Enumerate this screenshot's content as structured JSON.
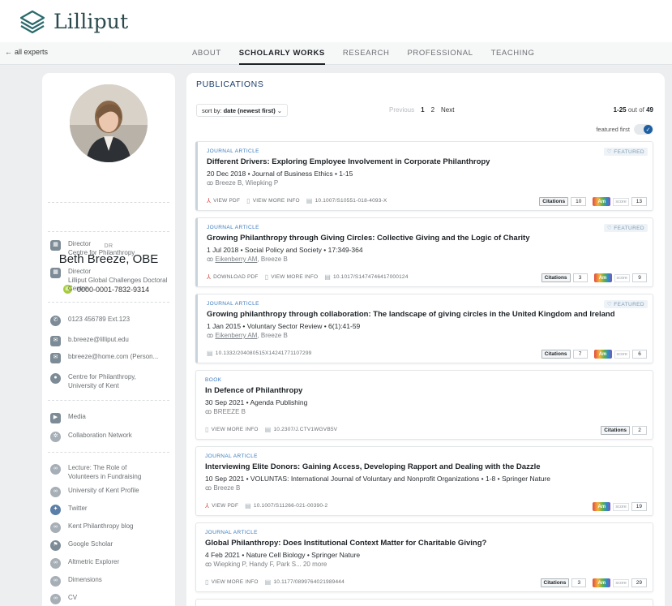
{
  "brand": {
    "name": "Lilliput"
  },
  "nav": {
    "back_label": "all experts",
    "tabs": [
      "ABOUT",
      "SCHOLARLY WORKS",
      "RESEARCH",
      "PROFESSIONAL",
      "TEACHING"
    ],
    "active_tab": "SCHOLARLY WORKS"
  },
  "profile": {
    "prefix": "DR",
    "name": "Beth Breeze, OBE",
    "orcid": "0000-0001-7832-9314",
    "orcid_badge": "iD",
    "positions": [
      {
        "title": "Director",
        "org": "Centre for Philanthropy"
      },
      {
        "title": "Director",
        "org": "Lilliput Global Challenges Doctoral Centre"
      }
    ],
    "contacts": {
      "phone": "0123 456789 Ext.123",
      "email_work": "b.breeze@lilliput.edu",
      "email_personal": "bbreeze@home.com (Person...",
      "location": "Centre for Philanthropy, University of Kent"
    },
    "media_links": [
      "Media",
      "Collaboration Network"
    ],
    "web_links": [
      "Lecture: The Role of Volunteers in Fundraising",
      "University of Kent Profile",
      "Twitter",
      "Kent Philanthropy blog",
      "Google Scholar",
      "Altmetric Explorer",
      "Dimensions",
      "CV"
    ]
  },
  "publications": {
    "heading": "PUBLICATIONS",
    "sort_prefix": "sort by:",
    "sort_value": "date (newest first)",
    "pager": {
      "previous": "Previous",
      "pages": [
        "1",
        "2"
      ],
      "current": "1",
      "next": "Next"
    },
    "range": "1-25",
    "out_of": "out of",
    "total": "49",
    "featured_first_label": "featured first",
    "citations_label": "Citations",
    "altmetric_label": "Am",
    "score_label": "score",
    "featured_label": "FEATURED",
    "items": [
      {
        "type": "JOURNAL ARTICLE",
        "featured": true,
        "title": "Different Drivers: Exploring Employee Involvement in Corporate Philanthropy",
        "meta": "20 Dec 2018  •  Journal of Business Ethics  •  1-15",
        "authors_plain": "Breeze B, Wiepking P",
        "authors_linked": "",
        "links": [
          "VIEW PDF",
          "VIEW MORE INFO"
        ],
        "doi": "10.1007/S10551-018-4093-X",
        "citations": "10",
        "altmetric": "13"
      },
      {
        "type": "JOURNAL ARTICLE",
        "featured": true,
        "title": "Growing Philanthropy through Giving Circles: Collective Giving and the Logic of Charity",
        "meta": "1 Jul 2018  •  Social Policy and Society  •  17:349-364",
        "authors_plain": ", Breeze B",
        "authors_linked": "Eikenberry AM",
        "links": [
          "DOWNLOAD PDF",
          "VIEW MORE INFO"
        ],
        "doi": "10.1017/S1474746417000124",
        "citations": "3",
        "altmetric": "9"
      },
      {
        "type": "JOURNAL ARTICLE",
        "featured": true,
        "title": "Growing philanthropy through collaboration: The landscape of giving circles in the United Kingdom and Ireland",
        "meta": "1 Jan 2015  •  Voluntary Sector Review  •  6(1):41-59",
        "authors_plain": ", Breeze B",
        "authors_linked": "Eikenberry AM",
        "links": [],
        "doi": "10.1332/204080515X14241771107299",
        "citations": "7",
        "altmetric": "6"
      },
      {
        "type": "BOOK",
        "featured": false,
        "title": "In Defence of Philanthropy",
        "meta": "30 Sep 2021  •  Agenda Publishing",
        "authors_plain": "BREEZE B",
        "authors_linked": "",
        "links": [
          "VIEW MORE INFO"
        ],
        "doi": "10.2307/J.CTV1WGVB5V",
        "citations": "2",
        "altmetric": ""
      },
      {
        "type": "JOURNAL ARTICLE",
        "featured": false,
        "title": "Interviewing Elite Donors: Gaining Access, Developing Rapport and Dealing with the Dazzle",
        "meta": "10 Sep 2021  •  VOLUNTAS: International Journal of Voluntary and Nonprofit Organizations  •  1-8  •  Springer Nature",
        "authors_plain": "Breeze B",
        "authors_linked": "",
        "links": [
          "VIEW PDF"
        ],
        "doi": "10.1007/S11266-021-00390-2",
        "citations": "",
        "altmetric": "19"
      },
      {
        "type": "JOURNAL ARTICLE",
        "featured": false,
        "title": "Global Philanthropy: Does Institutional Context Matter for Charitable Giving?",
        "meta": "4 Feb 2021  •  Nature Cell Biology  •  Springer Nature",
        "authors_plain": "Wiepking P, Handy F, Park S... 20 more",
        "authors_linked": "",
        "links": [
          "VIEW MORE INFO"
        ],
        "doi": "10.1177/0899764021989444",
        "citations": "3",
        "altmetric": "29"
      }
    ]
  },
  "colors": {
    "accent": "#1d5fa0",
    "orcid": "#a6ce39",
    "pdf": "#d9534f"
  },
  "icons": {
    "position": "building-icon",
    "phone": "phone-icon",
    "email": "email-icon",
    "location": "location-pin-icon",
    "media": "media-icon",
    "network": "network-icon",
    "link": "link-icon",
    "twitter": "twitter-icon",
    "scholar": "google-scholar-icon"
  }
}
